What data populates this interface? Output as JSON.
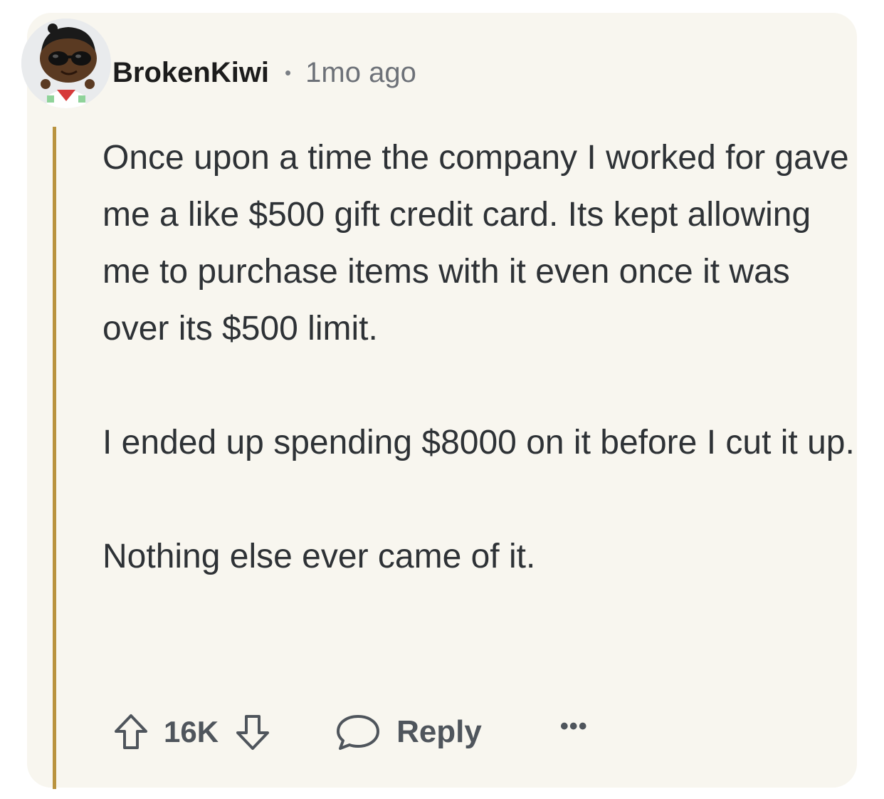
{
  "comment": {
    "username": "BrokenKiwi",
    "separator": "•",
    "timestamp": "1mo ago",
    "paragraphs": [
      "Once upon a time the company I worked for gave me a like $500 gift credit card. Its kept allowing me to purchase items with it even once it was over its $500 limit.",
      "I ended up spending $8000 on it before I cut it up.",
      "Nothing else ever came of it."
    ],
    "thread_line_color": "#b9933f"
  },
  "actions": {
    "upvote_icon": "arrow-up-icon",
    "score": "16K",
    "downvote_icon": "arrow-down-icon",
    "reply_icon": "speech-bubble-icon",
    "reply_label": "Reply",
    "more_label": "•••"
  }
}
